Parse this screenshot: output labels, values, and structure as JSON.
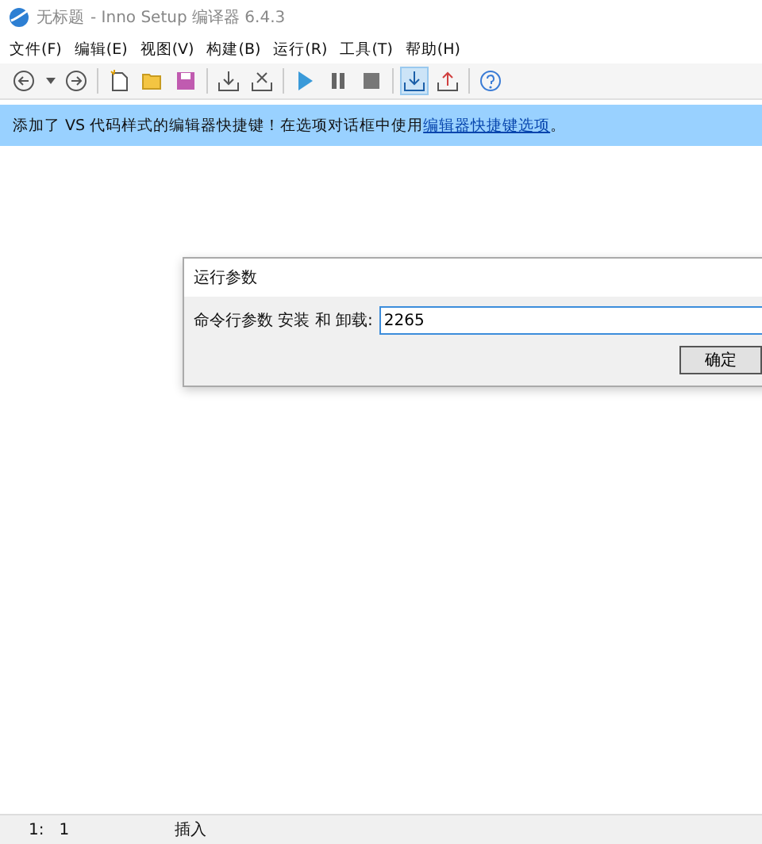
{
  "window": {
    "title_document": "无标题",
    "title_app": "- Inno Setup 编译器 6.4.3"
  },
  "menu": [
    "文件(F)",
    "编辑(E)",
    "视图(V)",
    "构建(B)",
    "运行(R)",
    "工具(T)",
    "帮助(H)"
  ],
  "toolbar": [
    {
      "kind": "back"
    },
    {
      "kind": "dropdown"
    },
    {
      "kind": "forward"
    },
    {
      "kind": "sep"
    },
    {
      "kind": "new"
    },
    {
      "kind": "open"
    },
    {
      "kind": "save"
    },
    {
      "kind": "sep"
    },
    {
      "kind": "compile"
    },
    {
      "kind": "stopcompile"
    },
    {
      "kind": "sep"
    },
    {
      "kind": "run"
    },
    {
      "kind": "pause"
    },
    {
      "kind": "stop"
    },
    {
      "kind": "sep"
    },
    {
      "kind": "targetinstall",
      "selected": true
    },
    {
      "kind": "targetuninstall",
      "selected": false
    },
    {
      "kind": "sep"
    },
    {
      "kind": "help"
    }
  ],
  "banner": {
    "text": "添加了 VS 代码样式的编辑器快捷键！在选项对话框中使用",
    "link": "编辑器快捷键选项",
    "suffix": "。"
  },
  "dialog": {
    "title": "运行参数",
    "label": "命令行参数 安装 和 卸载:",
    "value": "2265",
    "button": "确定"
  },
  "status_bar": {
    "position": "1:   1",
    "mode": "插入"
  }
}
